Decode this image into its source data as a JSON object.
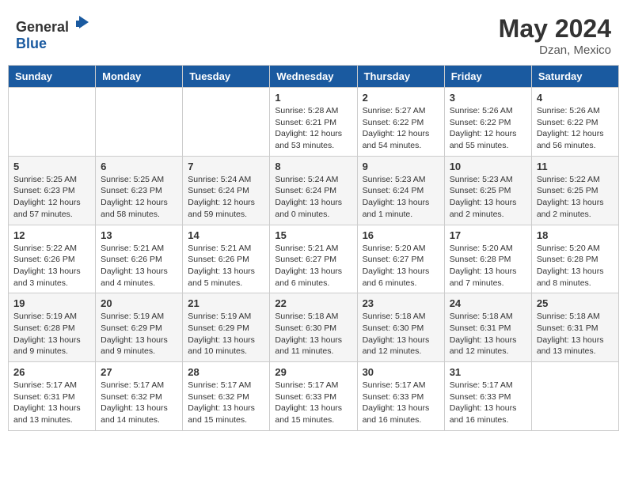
{
  "header": {
    "logo_general": "General",
    "logo_blue": "Blue",
    "month": "May 2024",
    "location": "Dzan, Mexico"
  },
  "days_of_week": [
    "Sunday",
    "Monday",
    "Tuesday",
    "Wednesday",
    "Thursday",
    "Friday",
    "Saturday"
  ],
  "weeks": [
    [
      {
        "day": "",
        "info": ""
      },
      {
        "day": "",
        "info": ""
      },
      {
        "day": "",
        "info": ""
      },
      {
        "day": "1",
        "info": "Sunrise: 5:28 AM\nSunset: 6:21 PM\nDaylight: 12 hours\nand 53 minutes."
      },
      {
        "day": "2",
        "info": "Sunrise: 5:27 AM\nSunset: 6:22 PM\nDaylight: 12 hours\nand 54 minutes."
      },
      {
        "day": "3",
        "info": "Sunrise: 5:26 AM\nSunset: 6:22 PM\nDaylight: 12 hours\nand 55 minutes."
      },
      {
        "day": "4",
        "info": "Sunrise: 5:26 AM\nSunset: 6:22 PM\nDaylight: 12 hours\nand 56 minutes."
      }
    ],
    [
      {
        "day": "5",
        "info": "Sunrise: 5:25 AM\nSunset: 6:23 PM\nDaylight: 12 hours\nand 57 minutes."
      },
      {
        "day": "6",
        "info": "Sunrise: 5:25 AM\nSunset: 6:23 PM\nDaylight: 12 hours\nand 58 minutes."
      },
      {
        "day": "7",
        "info": "Sunrise: 5:24 AM\nSunset: 6:24 PM\nDaylight: 12 hours\nand 59 minutes."
      },
      {
        "day": "8",
        "info": "Sunrise: 5:24 AM\nSunset: 6:24 PM\nDaylight: 13 hours\nand 0 minutes."
      },
      {
        "day": "9",
        "info": "Sunrise: 5:23 AM\nSunset: 6:24 PM\nDaylight: 13 hours\nand 1 minute."
      },
      {
        "day": "10",
        "info": "Sunrise: 5:23 AM\nSunset: 6:25 PM\nDaylight: 13 hours\nand 2 minutes."
      },
      {
        "day": "11",
        "info": "Sunrise: 5:22 AM\nSunset: 6:25 PM\nDaylight: 13 hours\nand 2 minutes."
      }
    ],
    [
      {
        "day": "12",
        "info": "Sunrise: 5:22 AM\nSunset: 6:26 PM\nDaylight: 13 hours\nand 3 minutes."
      },
      {
        "day": "13",
        "info": "Sunrise: 5:21 AM\nSunset: 6:26 PM\nDaylight: 13 hours\nand 4 minutes."
      },
      {
        "day": "14",
        "info": "Sunrise: 5:21 AM\nSunset: 6:26 PM\nDaylight: 13 hours\nand 5 minutes."
      },
      {
        "day": "15",
        "info": "Sunrise: 5:21 AM\nSunset: 6:27 PM\nDaylight: 13 hours\nand 6 minutes."
      },
      {
        "day": "16",
        "info": "Sunrise: 5:20 AM\nSunset: 6:27 PM\nDaylight: 13 hours\nand 6 minutes."
      },
      {
        "day": "17",
        "info": "Sunrise: 5:20 AM\nSunset: 6:28 PM\nDaylight: 13 hours\nand 7 minutes."
      },
      {
        "day": "18",
        "info": "Sunrise: 5:20 AM\nSunset: 6:28 PM\nDaylight: 13 hours\nand 8 minutes."
      }
    ],
    [
      {
        "day": "19",
        "info": "Sunrise: 5:19 AM\nSunset: 6:28 PM\nDaylight: 13 hours\nand 9 minutes."
      },
      {
        "day": "20",
        "info": "Sunrise: 5:19 AM\nSunset: 6:29 PM\nDaylight: 13 hours\nand 9 minutes."
      },
      {
        "day": "21",
        "info": "Sunrise: 5:19 AM\nSunset: 6:29 PM\nDaylight: 13 hours\nand 10 minutes."
      },
      {
        "day": "22",
        "info": "Sunrise: 5:18 AM\nSunset: 6:30 PM\nDaylight: 13 hours\nand 11 minutes."
      },
      {
        "day": "23",
        "info": "Sunrise: 5:18 AM\nSunset: 6:30 PM\nDaylight: 13 hours\nand 12 minutes."
      },
      {
        "day": "24",
        "info": "Sunrise: 5:18 AM\nSunset: 6:31 PM\nDaylight: 13 hours\nand 12 minutes."
      },
      {
        "day": "25",
        "info": "Sunrise: 5:18 AM\nSunset: 6:31 PM\nDaylight: 13 hours\nand 13 minutes."
      }
    ],
    [
      {
        "day": "26",
        "info": "Sunrise: 5:17 AM\nSunset: 6:31 PM\nDaylight: 13 hours\nand 13 minutes."
      },
      {
        "day": "27",
        "info": "Sunrise: 5:17 AM\nSunset: 6:32 PM\nDaylight: 13 hours\nand 14 minutes."
      },
      {
        "day": "28",
        "info": "Sunrise: 5:17 AM\nSunset: 6:32 PM\nDaylight: 13 hours\nand 15 minutes."
      },
      {
        "day": "29",
        "info": "Sunrise: 5:17 AM\nSunset: 6:33 PM\nDaylight: 13 hours\nand 15 minutes."
      },
      {
        "day": "30",
        "info": "Sunrise: 5:17 AM\nSunset: 6:33 PM\nDaylight: 13 hours\nand 16 minutes."
      },
      {
        "day": "31",
        "info": "Sunrise: 5:17 AM\nSunset: 6:33 PM\nDaylight: 13 hours\nand 16 minutes."
      },
      {
        "day": "",
        "info": ""
      }
    ]
  ]
}
